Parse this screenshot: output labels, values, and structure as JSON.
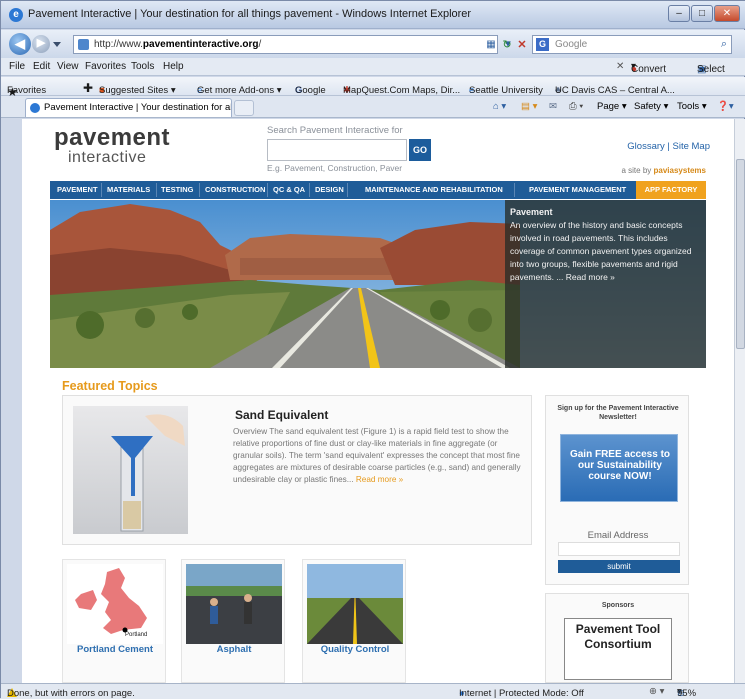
{
  "window": {
    "title": "Pavement Interactive | Your destination for all things pavement - Windows Internet Explorer",
    "min_label": "–",
    "max_label": "□",
    "close_label": "✕"
  },
  "nav": {
    "back_glyph": "◀",
    "forward_glyph": "▶",
    "url_prefix": "http://www.",
    "url_domain": "pavementinteractive.org",
    "url_suffix": "/",
    "search_placeholder": "Google",
    "search_glyph": "⌕"
  },
  "menu": {
    "items": [
      "File",
      "Edit",
      "View",
      "Favorites",
      "Tools",
      "Help"
    ],
    "convert": "Convert",
    "select": "Select"
  },
  "favorites": {
    "label": "Favorites",
    "items": [
      "Suggested Sites ▾",
      "Get more Add-ons ▾",
      "Google",
      "MapQuest.Com Maps, Dir...",
      "Seattle University",
      "UC Davis CAS – Central A..."
    ]
  },
  "tabs": {
    "active": "Pavement Interactive | Your destination for all thi...",
    "commands": [
      "Page ▾",
      "Safety ▾",
      "Tools ▾"
    ]
  },
  "site": {
    "logo_line1": "pavement",
    "logo_line2": "interactive",
    "search_label": "Search Pavement Interactive for",
    "go_label": "GO",
    "search_hint": "E.g. Pavement, Construction, Paver",
    "top_links": "Glossary | Site Map",
    "site_by": "a site by",
    "site_by_brand": "paviasystems",
    "nav_items": [
      "PAVEMENT",
      "MATERIALS",
      "TESTING",
      "CONSTRUCTION",
      "QC & QA",
      "DESIGN",
      "MAINTENANCE AND REHABILITATION",
      "PAVEMENT MANAGEMENT"
    ],
    "nav_app": "APP FACTORY",
    "hero_heading": "Pavement",
    "hero_text": "An overview of the history and basic concepts involved in road pavements. This includes coverage of common pavement types organized into two groups, flexible pavements and rigid pavements. ... Read more »",
    "featured_heading": "Featured Topics",
    "feature_title": "Sand Equivalent",
    "feature_text": "Overview The sand equivalent test (Figure 1) is a rapid field test to show the relative proportions of fine dust or clay-like materials in fine aggregate (or granular soils). The term 'sand equivalent' expresses the concept that most fine aggregates are mixtures of desirable coarse particles (e.g., sand) and generally undesirable clay or plastic fines...",
    "feature_more": "Read more »",
    "newsletter_heading": "Sign up for the Pavement Interactive Newsletter!",
    "ad_text": "Gain FREE access to our Sustainability course NOW!",
    "email_label": "Email Address",
    "submit_label": "submit",
    "sponsors_heading": "Sponsors",
    "sponsor_box": "Pavement Tool Consortium",
    "map_label": "Portland",
    "cards": [
      "Portland Cement",
      "Asphalt",
      "Quality Control"
    ]
  },
  "status": {
    "text": "Done, but with errors on page.",
    "zone": "Internet | Protected Mode: Off",
    "zoom": "95%"
  },
  "colors": {
    "nav_blue": "#1f5c98",
    "accent_orange": "#f0a21e",
    "link_blue": "#2e6fb0"
  }
}
